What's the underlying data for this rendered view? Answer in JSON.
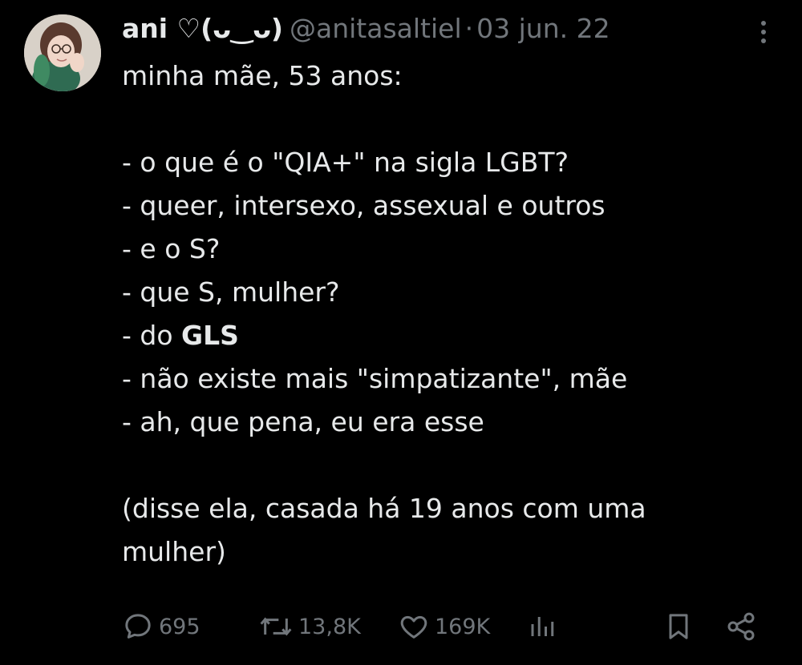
{
  "tweet": {
    "display_name": "ani ♡(ᴗ‿ᴗ)",
    "handle": "@anitasaltiel",
    "separator": "·",
    "date": "03 jun. 22",
    "lines": [
      "minha mãe, 53 anos:",
      "",
      "- o que é o \"QIA+\" na sigla LGBT?",
      "- queer, intersexo, assexual e outros",
      "- e o S?",
      "- que S, mulher?",
      "- do ",
      "- não existe mais \"simpatizante\", mãe",
      "- ah, que pena, eu era esse",
      "",
      "(disse ela, casada há 19 anos com uma mulher)"
    ],
    "bold_fragment": "GLS",
    "stats": {
      "replies": "695",
      "retweets": "13,8K",
      "likes": "169K"
    }
  },
  "icons": {
    "more": "more-vertical-icon",
    "reply": "reply-icon",
    "retweet": "retweet-icon",
    "like": "heart-icon",
    "views": "views-chart-icon",
    "bookmark": "bookmark-icon",
    "share": "share-icon"
  },
  "colors": {
    "background": "#000000",
    "text_primary": "#e7e9ea",
    "text_secondary": "#71767b"
  }
}
